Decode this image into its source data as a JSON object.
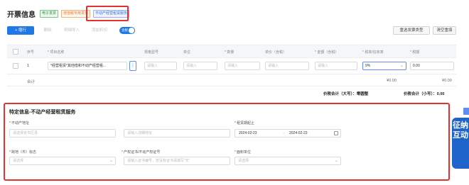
{
  "header": {
    "title": "开票信息",
    "tags": [
      "电子发票",
      "增值税专用发票",
      "不动产经营租赁服务"
    ]
  },
  "toolbar": {
    "add": "+ 增行",
    "delete": "删除",
    "merge": "明细导入",
    "add_discount": "添加折扣",
    "toggle": "含税",
    "select_type": "重选发票类型",
    "clear": "清空重填"
  },
  "table": {
    "headers": {
      "index": "序号",
      "item_name": "* 项目名称",
      "spec": "规格型号",
      "unit": "单位",
      "qty": "* 数量",
      "price": "单价（含税）",
      "amount": "* 金额（含税）",
      "tax_rate": "* 税率/征收率",
      "tax": "* 税额"
    },
    "row": {
      "index": "1",
      "item_name": "*经营租赁*其他借和不动产经营租...",
      "spec_placeholder": "请输入",
      "unit_placeholder": "请输入",
      "qty_placeholder": "请输入",
      "price_placeholder": "请输入",
      "amount_placeholder": "请输入",
      "tax_rate": "9%",
      "tax": "0.00"
    },
    "subtotal_label": "合计",
    "subtotal_amount": "¥0.00",
    "subtotal_tax": "¥0.00",
    "total_upper": "价税合计（大写）：零圆整",
    "total_lower": "价税合计（小写）：0.00"
  },
  "special": {
    "title": "特定信息-不动产经营租赁服务",
    "address_label": "不动产地址",
    "address_placeholder": "请选择省市区县",
    "detail_placeholder": "请输入详细地址",
    "period_label": "租赁期起止",
    "start_date": "2024-02-23",
    "date_sep": "-",
    "end_date": "2024-02-23",
    "cross_city_label": "跨地（市）标志",
    "cross_city_placeholder": "请选择",
    "cert_label": "产权证书/不动产权证号",
    "cert_placeholder": "请输入证书编号，若没有证书请填写“无”",
    "area_unit_label": "面积单位",
    "area_unit_placeholder": "请选择"
  },
  "side": {
    "float_text": "征纳互动"
  },
  "colors": {
    "primary": "#1e78e6",
    "highlight": "#e0332e"
  }
}
